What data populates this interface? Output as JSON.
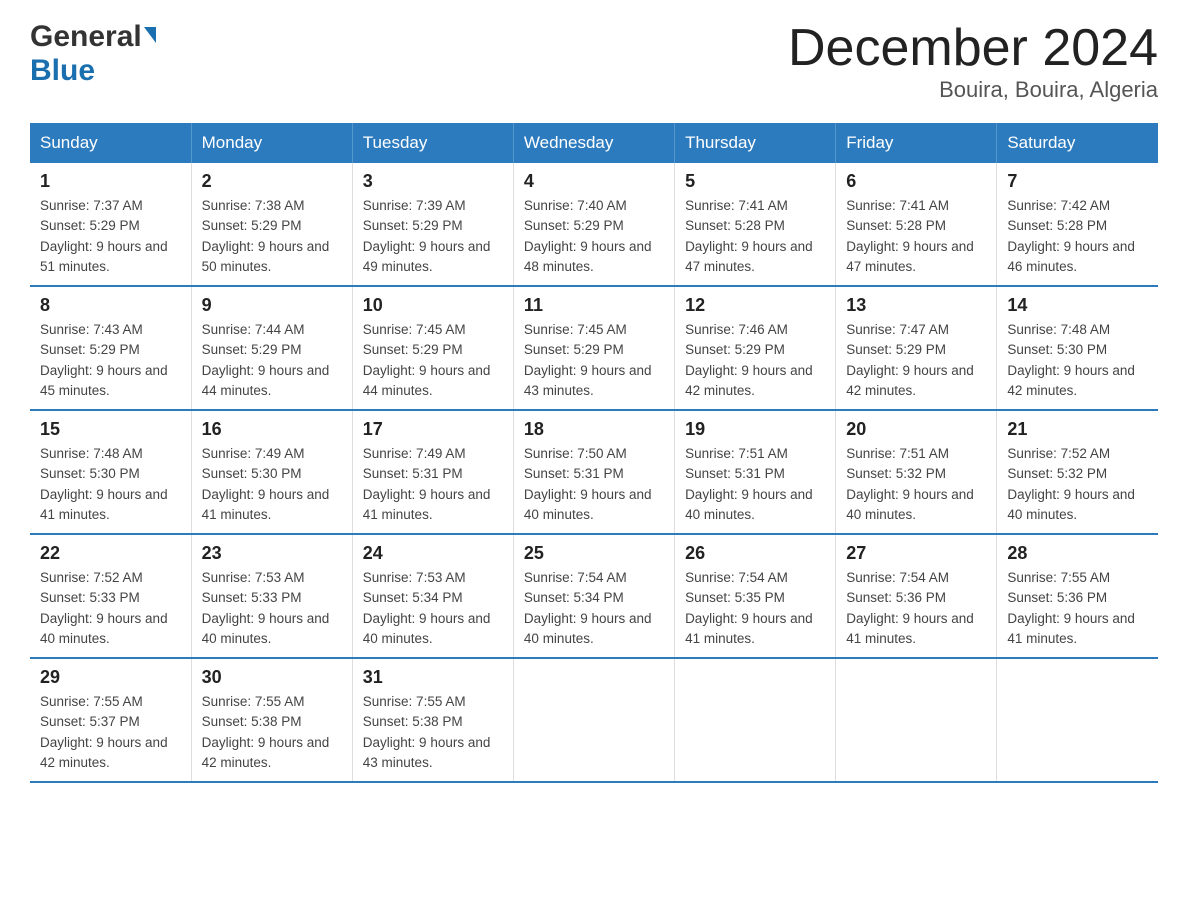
{
  "header": {
    "logo_general": "General",
    "logo_blue": "Blue",
    "title": "December 2024",
    "subtitle": "Bouira, Bouira, Algeria"
  },
  "weekdays": [
    "Sunday",
    "Monday",
    "Tuesday",
    "Wednesday",
    "Thursday",
    "Friday",
    "Saturday"
  ],
  "weeks": [
    [
      {
        "day": "1",
        "sunrise": "7:37 AM",
        "sunset": "5:29 PM",
        "daylight": "9 hours and 51 minutes."
      },
      {
        "day": "2",
        "sunrise": "7:38 AM",
        "sunset": "5:29 PM",
        "daylight": "9 hours and 50 minutes."
      },
      {
        "day": "3",
        "sunrise": "7:39 AM",
        "sunset": "5:29 PM",
        "daylight": "9 hours and 49 minutes."
      },
      {
        "day": "4",
        "sunrise": "7:40 AM",
        "sunset": "5:29 PM",
        "daylight": "9 hours and 48 minutes."
      },
      {
        "day": "5",
        "sunrise": "7:41 AM",
        "sunset": "5:28 PM",
        "daylight": "9 hours and 47 minutes."
      },
      {
        "day": "6",
        "sunrise": "7:41 AM",
        "sunset": "5:28 PM",
        "daylight": "9 hours and 47 minutes."
      },
      {
        "day": "7",
        "sunrise": "7:42 AM",
        "sunset": "5:28 PM",
        "daylight": "9 hours and 46 minutes."
      }
    ],
    [
      {
        "day": "8",
        "sunrise": "7:43 AM",
        "sunset": "5:29 PM",
        "daylight": "9 hours and 45 minutes."
      },
      {
        "day": "9",
        "sunrise": "7:44 AM",
        "sunset": "5:29 PM",
        "daylight": "9 hours and 44 minutes."
      },
      {
        "day": "10",
        "sunrise": "7:45 AM",
        "sunset": "5:29 PM",
        "daylight": "9 hours and 44 minutes."
      },
      {
        "day": "11",
        "sunrise": "7:45 AM",
        "sunset": "5:29 PM",
        "daylight": "9 hours and 43 minutes."
      },
      {
        "day": "12",
        "sunrise": "7:46 AM",
        "sunset": "5:29 PM",
        "daylight": "9 hours and 42 minutes."
      },
      {
        "day": "13",
        "sunrise": "7:47 AM",
        "sunset": "5:29 PM",
        "daylight": "9 hours and 42 minutes."
      },
      {
        "day": "14",
        "sunrise": "7:48 AM",
        "sunset": "5:30 PM",
        "daylight": "9 hours and 42 minutes."
      }
    ],
    [
      {
        "day": "15",
        "sunrise": "7:48 AM",
        "sunset": "5:30 PM",
        "daylight": "9 hours and 41 minutes."
      },
      {
        "day": "16",
        "sunrise": "7:49 AM",
        "sunset": "5:30 PM",
        "daylight": "9 hours and 41 minutes."
      },
      {
        "day": "17",
        "sunrise": "7:49 AM",
        "sunset": "5:31 PM",
        "daylight": "9 hours and 41 minutes."
      },
      {
        "day": "18",
        "sunrise": "7:50 AM",
        "sunset": "5:31 PM",
        "daylight": "9 hours and 40 minutes."
      },
      {
        "day": "19",
        "sunrise": "7:51 AM",
        "sunset": "5:31 PM",
        "daylight": "9 hours and 40 minutes."
      },
      {
        "day": "20",
        "sunrise": "7:51 AM",
        "sunset": "5:32 PM",
        "daylight": "9 hours and 40 minutes."
      },
      {
        "day": "21",
        "sunrise": "7:52 AM",
        "sunset": "5:32 PM",
        "daylight": "9 hours and 40 minutes."
      }
    ],
    [
      {
        "day": "22",
        "sunrise": "7:52 AM",
        "sunset": "5:33 PM",
        "daylight": "9 hours and 40 minutes."
      },
      {
        "day": "23",
        "sunrise": "7:53 AM",
        "sunset": "5:33 PM",
        "daylight": "9 hours and 40 minutes."
      },
      {
        "day": "24",
        "sunrise": "7:53 AM",
        "sunset": "5:34 PM",
        "daylight": "9 hours and 40 minutes."
      },
      {
        "day": "25",
        "sunrise": "7:54 AM",
        "sunset": "5:34 PM",
        "daylight": "9 hours and 40 minutes."
      },
      {
        "day": "26",
        "sunrise": "7:54 AM",
        "sunset": "5:35 PM",
        "daylight": "9 hours and 41 minutes."
      },
      {
        "day": "27",
        "sunrise": "7:54 AM",
        "sunset": "5:36 PM",
        "daylight": "9 hours and 41 minutes."
      },
      {
        "day": "28",
        "sunrise": "7:55 AM",
        "sunset": "5:36 PM",
        "daylight": "9 hours and 41 minutes."
      }
    ],
    [
      {
        "day": "29",
        "sunrise": "7:55 AM",
        "sunset": "5:37 PM",
        "daylight": "9 hours and 42 minutes."
      },
      {
        "day": "30",
        "sunrise": "7:55 AM",
        "sunset": "5:38 PM",
        "daylight": "9 hours and 42 minutes."
      },
      {
        "day": "31",
        "sunrise": "7:55 AM",
        "sunset": "5:38 PM",
        "daylight": "9 hours and 43 minutes."
      },
      null,
      null,
      null,
      null
    ]
  ]
}
